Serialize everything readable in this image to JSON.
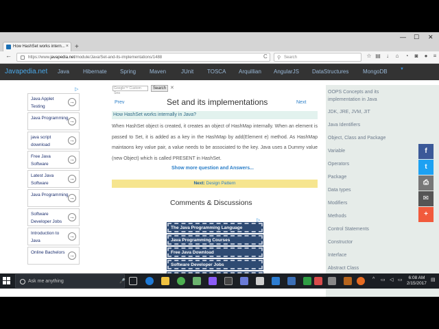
{
  "browser": {
    "tab_title": "How HashSet works intern...",
    "tab_close": "×",
    "new_tab": "+",
    "url_prefix": "https://www.",
    "url_domain": "javapedia.net",
    "url_path": "/module/Java/Set-and-its-implementations/1488",
    "search_placeholder": "Search",
    "window_min": "—",
    "window_max": "☐",
    "window_close": "✕",
    "back": "←",
    "info": "ⓘ",
    "reload": "C",
    "search_icon": "⚲"
  },
  "site": {
    "logo": "Javapedia.net",
    "menu": [
      "Java",
      "Hibernate",
      "Spring",
      "Maven",
      "JUnit",
      "TOSCA",
      "Arquillian",
      "AngularJS",
      "DataStructures",
      "MongoDB"
    ],
    "caret": "▼"
  },
  "left_ads": {
    "ad_marker": "▷",
    "items": [
      {
        "label": "Java Applet Testing",
        "arrow": "→"
      },
      {
        "label": "Java Programming",
        "arrow": "→"
      },
      {
        "label": "java script download",
        "arrow": "→"
      },
      {
        "label": "Free Java Software",
        "arrow": "→"
      },
      {
        "label": "Latest Java Software",
        "arrow": "→"
      },
      {
        "label": "Java Programming",
        "arrow": "→"
      },
      {
        "label": "Software Developer Jobs",
        "arrow": "→"
      },
      {
        "label": "Introduction to Java",
        "arrow": "→"
      },
      {
        "label": "Online Bachelors",
        "arrow": "→"
      }
    ]
  },
  "main": {
    "google_search_placeholder": "Google™ Custom Sea",
    "google_search_button": "Search",
    "google_clear": "✕",
    "prev": "Prev",
    "next": "Next",
    "title": "Set and its implementations",
    "question": "How HashSet works internally in Java?",
    "answer": "When HashSet object is created, it creates an object of HashMap internally. When an element is passed to Set, it is added as a key in the HashMap by add(Element e) method. As HashMap maintaons key value pair, a value needs to be associated to the key. Java uses a Dummy value (new Object) which is called PRESENT in HashSet.",
    "show_more": "Show more question and Answers...",
    "next_label": "Next:",
    "next_link": "Design Pattern",
    "comments_title": "Comments & Discussions",
    "ad_marker": "▷",
    "ad_buttons": [
      "The Java Programming Language",
      "Java Programming Courses",
      "Free Java Download",
      "Software Developer Jobs",
      ""
    ]
  },
  "sidebar": {
    "items": [
      "OOPS Concepts and its",
      "implementation in Java",
      "JDK, JRE, JVM, JIT",
      "Java Identifiers",
      "Object, Class and Package",
      "Variable",
      "Operators",
      "Package",
      "Data types",
      "Modifiers",
      "Methods",
      "Control Statements",
      "Constructor",
      "Interface",
      "Abstract Class"
    ]
  },
  "share": [
    {
      "icon": "f",
      "color": "#3b5998"
    },
    {
      "icon": "t",
      "color": "#1da1f2"
    },
    {
      "icon": "⎙",
      "color": "#777777"
    },
    {
      "icon": "✉",
      "color": "#555555"
    },
    {
      "icon": "+",
      "color": "#f15a3c"
    }
  ],
  "taskbar": {
    "search_placeholder": "Ask me anything",
    "mic": "🎤",
    "time": "6:08 AM",
    "date": "2/15/2017",
    "tray_up": "^"
  }
}
